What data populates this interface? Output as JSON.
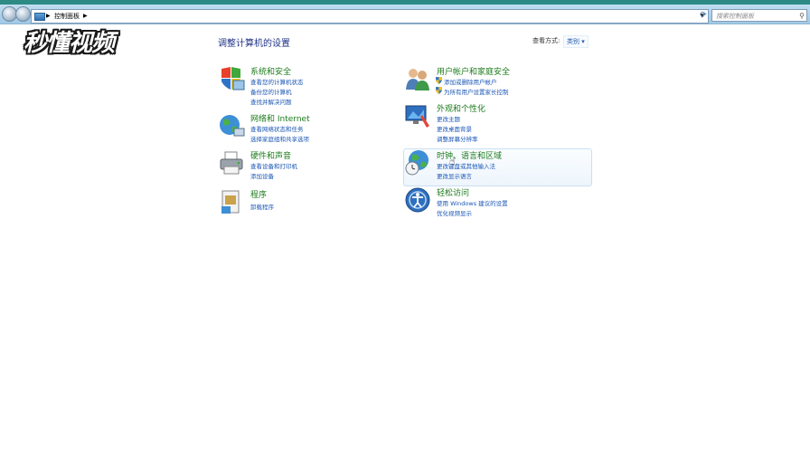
{
  "address": {
    "breadcrumb": "控制面板",
    "search_placeholder": "搜索控制面板"
  },
  "watermark": "秒懂视频",
  "page_title": "调整计算机的设置",
  "view_by": {
    "label": "查看方式:",
    "value": "类别 ▾"
  },
  "categories": [
    {
      "title": "系统和安全",
      "icon": "system-security-icon",
      "links": [
        "查看您的计算机状态",
        "备份您的计算机",
        "查找并解决问题"
      ]
    },
    {
      "title": "网络和 Internet",
      "icon": "network-globe-icon",
      "links": [
        "查看网络状态和任务",
        "选择家庭组和共享选项"
      ]
    },
    {
      "title": "硬件和声音",
      "icon": "printer-icon",
      "links": [
        "查看设备和打印机",
        "添加设备"
      ]
    },
    {
      "title": "程序",
      "icon": "programs-icon",
      "links": [
        "卸载程序"
      ]
    },
    {
      "title": "用户帐户和家庭安全",
      "icon": "users-icon",
      "links": [
        "添加或删除用户帐户",
        "为所有用户设置家长控制"
      ]
    },
    {
      "title": "外观和个性化",
      "icon": "appearance-icon",
      "links": [
        "更改主题",
        "更改桌面背景",
        "调整屏幕分辨率"
      ]
    },
    {
      "title": "时钟、语言和区域",
      "icon": "clock-globe-icon",
      "links": [
        "更改键盘或其他输入法",
        "更改显示语言"
      ]
    },
    {
      "title": "轻松访问",
      "icon": "ease-of-access-icon",
      "links": [
        "使用 Windows 建议的设置",
        "优化视频显示"
      ]
    }
  ]
}
